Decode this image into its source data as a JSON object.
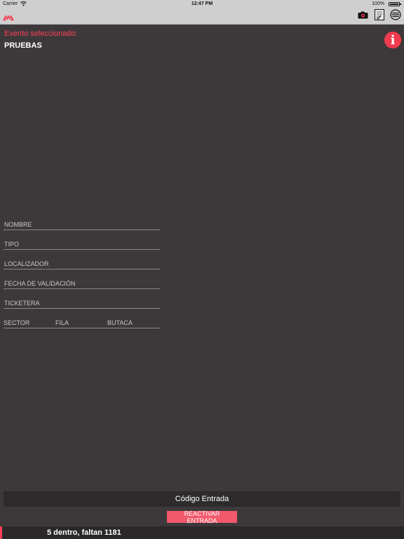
{
  "status_bar": {
    "carrier": "Carrier",
    "time": "12:47 PM",
    "battery": "100%"
  },
  "navbar": {
    "icons": [
      "logo-icon",
      "camera-icon",
      "document-icon",
      "menu-icon"
    ]
  },
  "event": {
    "label": "Evento seleccionado:",
    "name": "PRUEBAS"
  },
  "info_button": {
    "glyph": "i"
  },
  "fields": {
    "nombre": "NOMBRE",
    "tipo": "TIPO",
    "localizador": "LOCALIZADOR",
    "fecha": "FECHA DE VALIDACIÓN",
    "ticketera": "TICKETERA",
    "sector": "SECTOR",
    "fila": "FILA",
    "butaca": "BUTACA"
  },
  "code_entry": {
    "label": "Código Entrada"
  },
  "reactivate_button": {
    "label": "REACTIVAR ENTRADA"
  },
  "footer": {
    "count_text": "5 dentro, faltan 1181"
  },
  "colors": {
    "accent": "#ff3f5a",
    "background": "#3d393a",
    "navbar": "#cfcfcf",
    "button": "#f2596b"
  }
}
